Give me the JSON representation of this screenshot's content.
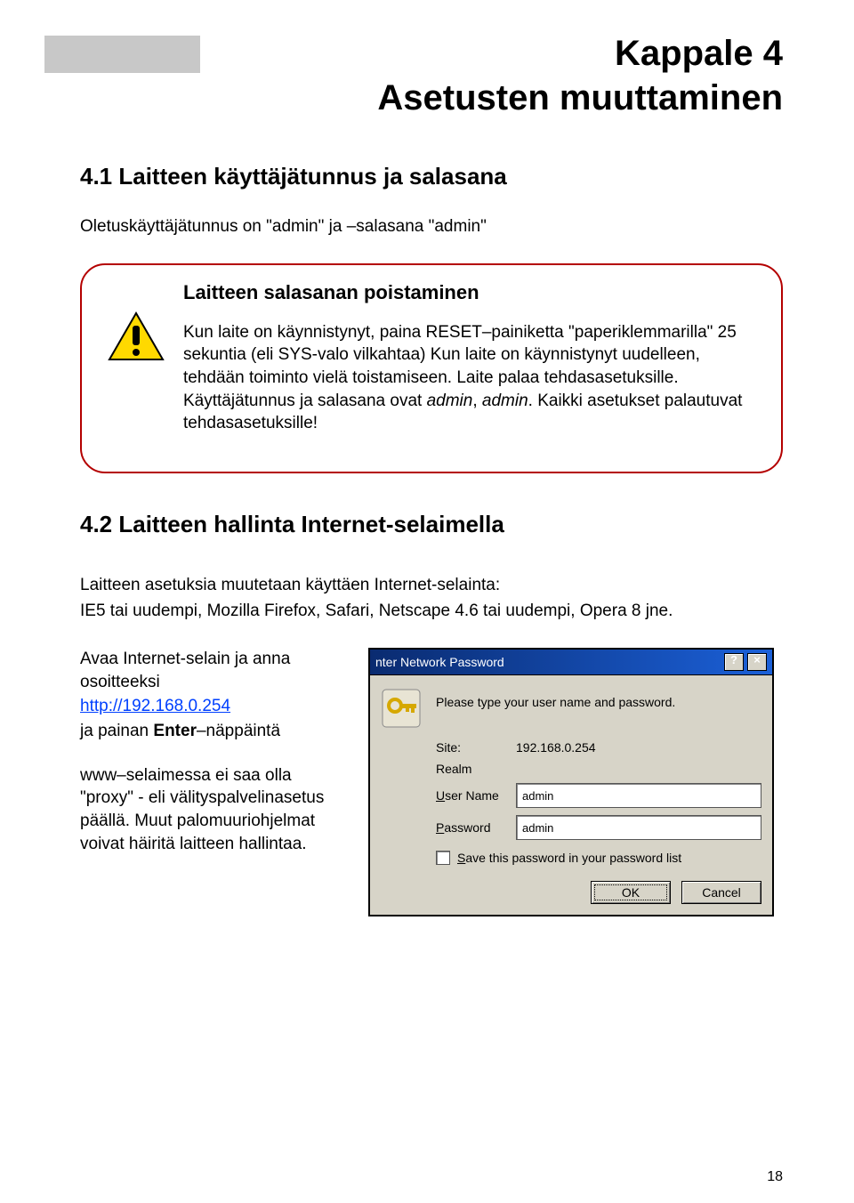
{
  "header": {
    "chapter": "Kappale 4",
    "title": "Asetusten muuttaminen"
  },
  "section41": {
    "heading": "4.1 Laitteen käyttäjätunnus ja salasana",
    "intro": "Oletuskäyttäjätunnus on \"admin\" ja –salasana \"admin\""
  },
  "callout": {
    "title": "Laitteen salasanan poistaminen",
    "body_pre": "Kun laite on käynnistynyt, paina RESET–painiketta \"paperiklemmarilla\" 25 sekuntia (eli SYS-valo vilkahtaa) Kun laite on käynnistynyt uudelleen, tehdään toiminto vielä toistamiseen. Laite palaa tehdasasetuksille. Käyttäjätunnus ja salasana ovat ",
    "body_em1": "admin",
    "body_mid": ", ",
    "body_em2": "admin",
    "body_post": ". Kaikki asetukset palautuvat tehdasasetuksille!"
  },
  "section42": {
    "heading": "4.2 Laitteen hallinta Internet-selaimella",
    "p1": "Laitteen asetuksia muutetaan käyttäen Internet-selainta:",
    "p2": "IE5 tai uudempi, Mozilla Firefox, Safari, Netscape 4.6 tai uudempi, Opera 8 jne."
  },
  "left": {
    "l1": "Avaa Internet-selain ja anna osoitteeksi",
    "url": "http://192.168.0.254",
    "l2_a": "ja painan ",
    "l2_b": "Enter",
    "l2_c": "–näppäintä",
    "l3": "www–selaimessa ei saa olla \"proxy\" - eli välityspalvelinasetus päällä. Muut palomuuriohjelmat voivat häiritä laitteen hallintaa."
  },
  "dialog": {
    "title": "nter Network Password",
    "prompt": "Please type your user name and password.",
    "site_label": "Site:",
    "site_value": "192.168.0.254",
    "realm_label": "Realm",
    "user_label": "User Name",
    "user_value": "admin",
    "pass_label": "Password",
    "pass_value": "admin",
    "save_label": "Save this password in your password list",
    "ok": "OK",
    "cancel": "Cancel",
    "help_btn": "?",
    "close_btn": "×"
  },
  "page_number": "18"
}
